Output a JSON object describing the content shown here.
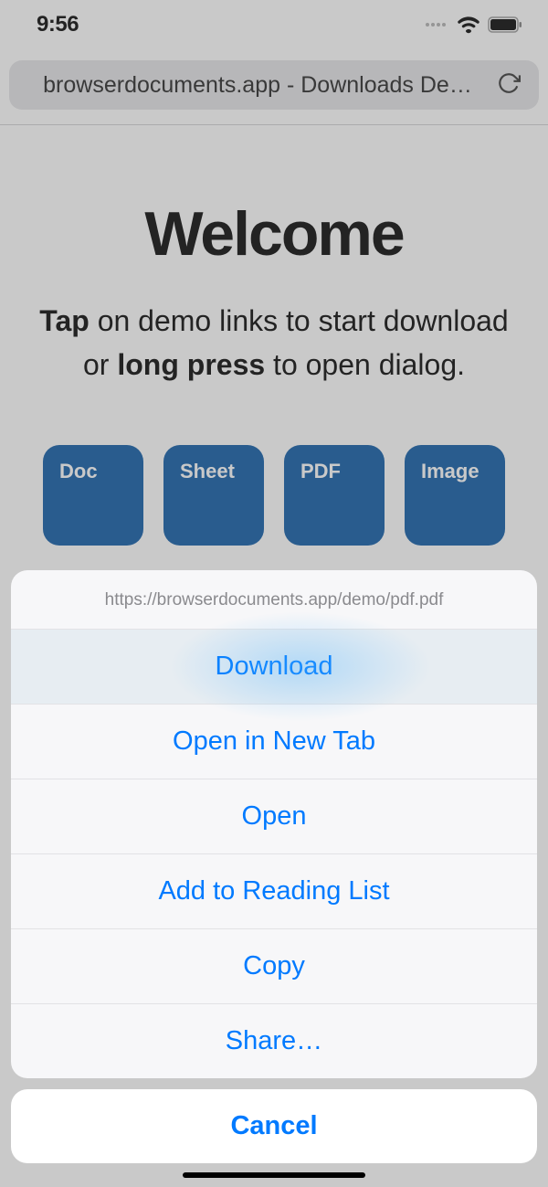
{
  "statusbar": {
    "time": "9:56"
  },
  "urlbar": {
    "text": "browserdocuments.app - Downloads De…"
  },
  "page": {
    "title": "Welcome",
    "instruction_part1": "Tap",
    "instruction_part2": " on demo links to start download or ",
    "instruction_part3": "long press",
    "instruction_part4": " to open dialog.",
    "tiles": {
      "doc": "Doc",
      "sheet": "Sheet",
      "pdf": "PDF",
      "image": "Image"
    }
  },
  "sheet": {
    "header": "https://browserdocuments.app/demo/pdf.pdf",
    "items": {
      "download": "Download",
      "new_tab": "Open in New Tab",
      "open": "Open",
      "reading_list": "Add to Reading List",
      "copy": "Copy",
      "share": "Share…"
    },
    "cancel": "Cancel"
  }
}
